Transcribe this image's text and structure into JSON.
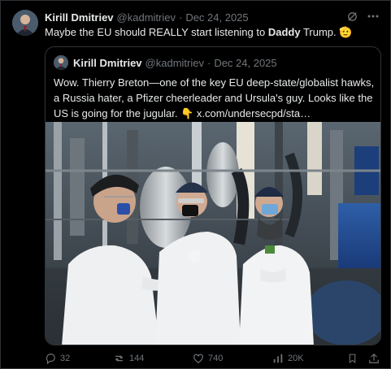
{
  "tweet": {
    "author_name": "Kirill Dmitriev",
    "handle": "@kadmitriev",
    "separator": "·",
    "date": "Dec 24, 2025",
    "text_prefix": "Maybe the EU should REALLY start listening to ",
    "text_bold": "Daddy",
    "text_suffix": " Trump.",
    "text_emoji": "🫡"
  },
  "quoted": {
    "author_name": "Kirill Dmitriev",
    "handle": "@kadmitriev",
    "separator": "·",
    "date": "Dec 24, 2025",
    "text": "Wow. Thierry Breton—one of the key EU deep-state/globalist hawks, a Russia hater, a Pfizer cheerleader and Ursula's guy. Looks like the US is going for the jugular.",
    "emoji": "👇",
    "link": "x.com/undersecpd/sta…"
  },
  "actions": {
    "replies": "32",
    "reposts": "144",
    "likes": "740",
    "views": "20K"
  },
  "icons": {
    "header": [
      "grok-icon",
      "more-icon"
    ],
    "footer": [
      "reply-icon",
      "repost-icon",
      "like-icon",
      "views-icon",
      "bookmark-icon",
      "share-icon"
    ]
  },
  "colors": {
    "background": "#000000",
    "text": "#e7e9ea",
    "muted": "#71767b",
    "border": "#2f3336"
  }
}
